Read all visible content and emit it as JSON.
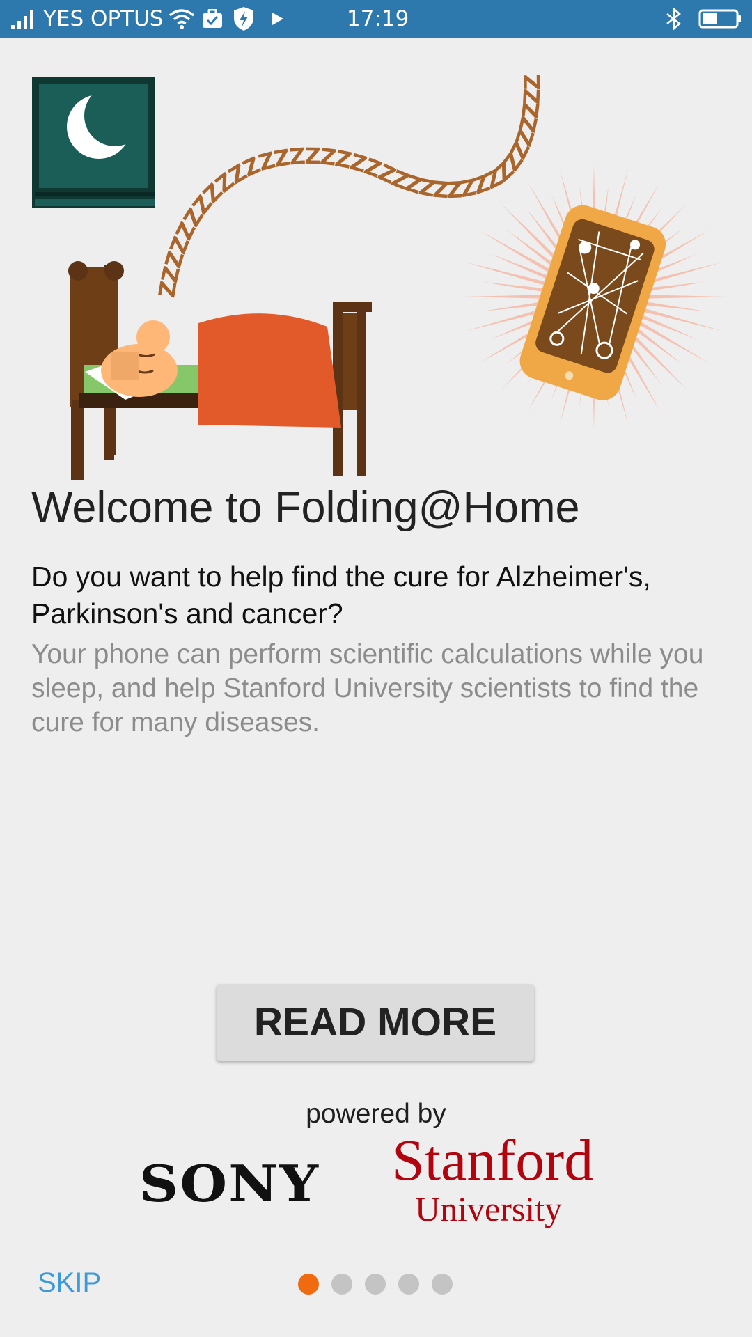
{
  "status_bar": {
    "carrier": "YES OPTUS",
    "time": "17:19",
    "icons": [
      "signal-icon",
      "wifi-icon",
      "briefcase-icon",
      "shield-icon",
      "play-icon",
      "bluetooth-icon",
      "battery-icon"
    ],
    "battery_level": 0.45,
    "background_color": "#2d78ad"
  },
  "illustration": {
    "snore_text": "ZZZZZZZZZZZZZZZZZZZZZZZZZZZZZZZZZZZZZZZ",
    "icons": [
      "moon-window-icon",
      "sleeping-person-in-bed-icon",
      "glowing-phone-icon"
    ]
  },
  "content": {
    "title": "Welcome to Folding@Home",
    "question": "Do you want to help find the cure for Alzheimer's, Parkinson's and cancer?",
    "description": "Your phone can perform scientific calculations while you sleep, and help Stanford University scientists to find the cure for many diseases."
  },
  "actions": {
    "read_more_label": "READ MORE"
  },
  "footer": {
    "powered_by": "powered by",
    "sony_logo": "SONY",
    "stanford_logo_top": "Stanford",
    "stanford_logo_bottom": "University",
    "stanford_color": "#b1040e"
  },
  "navigation": {
    "skip_label": "SKIP",
    "page_count": 5,
    "current_page": 1,
    "active_dot_color": "#f06a0f",
    "link_color": "#3c9ad9"
  }
}
